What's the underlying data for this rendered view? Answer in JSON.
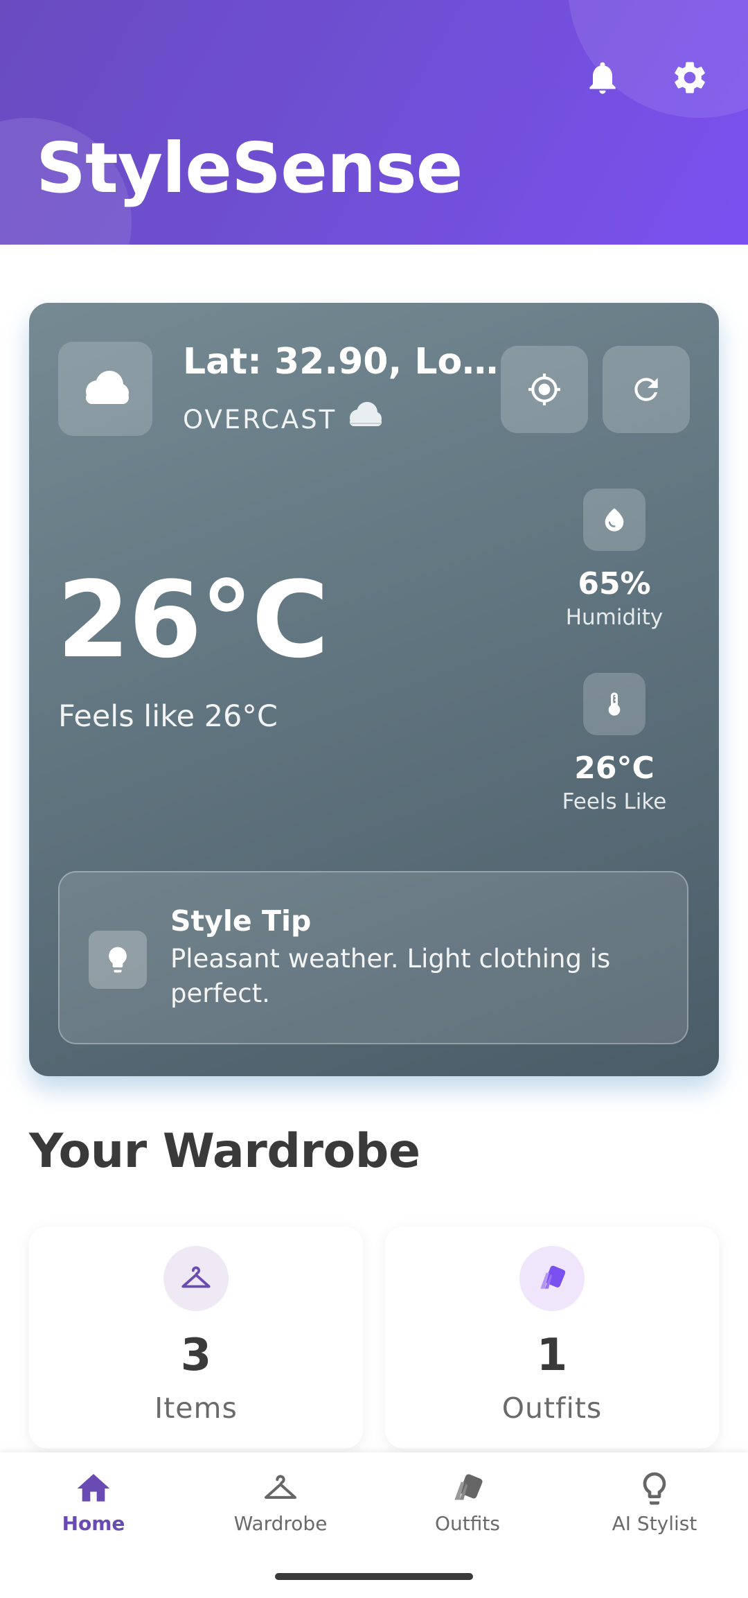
{
  "app": {
    "title": "StyleSense"
  },
  "header": {
    "icons": [
      "bell-icon",
      "gear-icon"
    ]
  },
  "weather": {
    "location": "Lat: 32.90, Lon…",
    "condition": "OVERCAST",
    "condition_emoji": "☁️",
    "temperature": "26°C",
    "feels_like_text": "Feels like 26°C",
    "stats": [
      {
        "value": "65%",
        "label": "Humidity",
        "icon": "water-drop-icon"
      },
      {
        "value": "26°C",
        "label": "Feels Like",
        "icon": "thermometer-icon"
      }
    ],
    "tip": {
      "title": "Style Tip",
      "text": "Pleasant weather. Light clothing is perfect."
    }
  },
  "wardrobe": {
    "title": "Your Wardrobe",
    "cards": [
      {
        "count": "3",
        "label": "Items",
        "icon": "hanger-icon"
      },
      {
        "count": "1",
        "label": "Outfits",
        "icon": "swatch-icon"
      }
    ]
  },
  "nav": {
    "items": [
      {
        "label": "Home",
        "icon": "home-icon",
        "active": true
      },
      {
        "label": "Wardrobe",
        "icon": "hanger-icon",
        "active": false
      },
      {
        "label": "Outfits",
        "icon": "swatch-icon",
        "active": false
      },
      {
        "label": "AI Stylist",
        "icon": "lightbulb-icon",
        "active": false
      }
    ]
  },
  "colors": {
    "header_gradient_start": "#6a4bc0",
    "header_gradient_end": "#7b50f0",
    "accent": "#6a4bb3",
    "weather_card": "#607480"
  }
}
